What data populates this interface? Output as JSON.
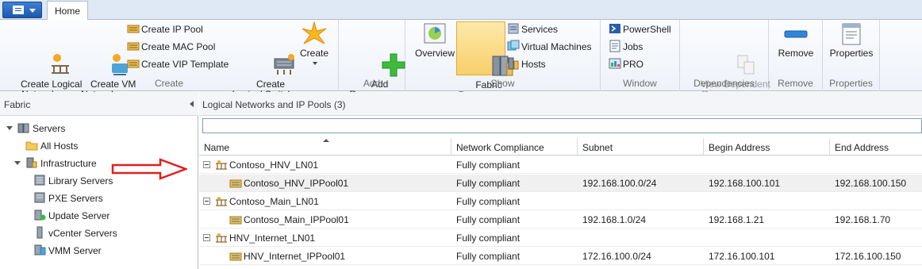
{
  "ribbon": {
    "tabs": [
      {
        "label": "Home"
      }
    ],
    "groups": {
      "create": {
        "label": "Create",
        "create_logical_network": "Create Logical\nNetwork",
        "create_vm_network": "Create VM\nNetwork",
        "create_ip_pool": "Create IP Pool",
        "create_mac_pool": "Create MAC Pool",
        "create_vip_template": "Create VIP Template",
        "create_logical_switch": "Create\nLogical Switch",
        "create": "Create"
      },
      "add": {
        "label": "Add",
        "add_resources": "Add\nResources"
      },
      "show": {
        "label": "Show",
        "overview": "Overview",
        "fabric_resources": "Fabric\nResources",
        "services": "Services",
        "virtual_machines": "Virtual Machines",
        "hosts": "Hosts"
      },
      "window": {
        "label": "Window",
        "powershell": "PowerShell",
        "jobs": "Jobs",
        "pro": "PRO"
      },
      "dependencies": {
        "label": "Dependencies",
        "view_dependent_resources": "View Dependent\nResources"
      },
      "remove": {
        "label": "Remove",
        "remove": "Remove"
      },
      "properties": {
        "label": "Properties",
        "properties": "Properties"
      }
    }
  },
  "nav": {
    "header": "Fabric",
    "items": [
      {
        "label": "Servers"
      },
      {
        "label": "All Hosts"
      },
      {
        "label": "Infrastructure"
      },
      {
        "label": "Library Servers"
      },
      {
        "label": "PXE Servers"
      },
      {
        "label": "Update Server"
      },
      {
        "label": "vCenter Servers"
      },
      {
        "label": "VMM Server"
      }
    ]
  },
  "main": {
    "header": "Logical Networks and IP Pools (3)",
    "search_value": "",
    "columns": [
      "Name",
      "Network Compliance",
      "Subnet",
      "Begin Address",
      "End Address"
    ],
    "rows": [
      {
        "name": "Contoso_HNV_LN01",
        "compliance": "Fully compliant",
        "subnet": "",
        "begin": "",
        "end": ""
      },
      {
        "name": "Contoso_HNV_IPPool01",
        "compliance": "Fully compliant",
        "subnet": "192.168.100.0/24",
        "begin": "192.168.100.101",
        "end": "192.168.100.150"
      },
      {
        "name": "Contoso_Main_LN01",
        "compliance": "Fully compliant",
        "subnet": "",
        "begin": "",
        "end": ""
      },
      {
        "name": "Contoso_Main_IPPool01",
        "compliance": "Fully compliant",
        "subnet": "192.168.1.0/24",
        "begin": "192.168.1.21",
        "end": "192.168.1.70"
      },
      {
        "name": "HNV_Internet_LN01",
        "compliance": "Fully compliant",
        "subnet": "",
        "begin": "",
        "end": ""
      },
      {
        "name": "HNV_Internet_IPPool01",
        "compliance": "Fully compliant",
        "subnet": "172.16.100.0/24",
        "begin": "172.16.100.101",
        "end": "172.16.100.150"
      }
    ]
  },
  "colors": {
    "accent": "#1c59b0",
    "selected_button": "#f8cf6b",
    "annotation_arrow": "#e02020"
  }
}
